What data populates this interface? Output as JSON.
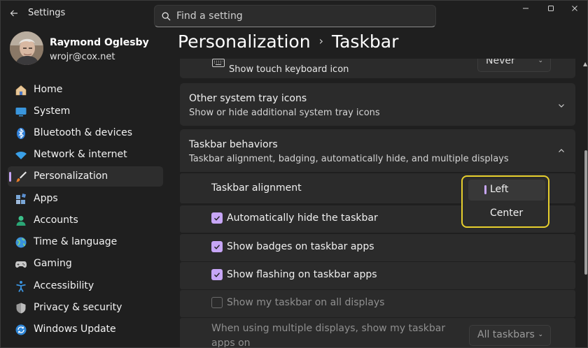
{
  "window": {
    "title": "Settings",
    "search_placeholder": "Find a setting"
  },
  "profile": {
    "name": "Raymond Oglesby",
    "email": "wrojr@cox.net"
  },
  "nav": {
    "items": [
      {
        "label": "Home",
        "icon": "home-icon"
      },
      {
        "label": "System",
        "icon": "system-icon"
      },
      {
        "label": "Bluetooth & devices",
        "icon": "bluetooth-icon"
      },
      {
        "label": "Network & internet",
        "icon": "wifi-icon"
      },
      {
        "label": "Personalization",
        "icon": "brush-icon",
        "active": true
      },
      {
        "label": "Apps",
        "icon": "apps-icon"
      },
      {
        "label": "Accounts",
        "icon": "accounts-icon"
      },
      {
        "label": "Time & language",
        "icon": "globe-icon"
      },
      {
        "label": "Gaming",
        "icon": "gamepad-icon"
      },
      {
        "label": "Accessibility",
        "icon": "accessibility-icon"
      },
      {
        "label": "Privacy & security",
        "icon": "shield-icon"
      },
      {
        "label": "Windows Update",
        "icon": "update-icon"
      }
    ]
  },
  "breadcrumb": {
    "parent": "Personalization",
    "separator": "›",
    "current": "Taskbar"
  },
  "touch_keyboard": {
    "subtitle": "Show touch keyboard icon",
    "dropdown_value": "Never"
  },
  "system_tray_card": {
    "title": "Other system tray icons",
    "subtitle": "Show or hide additional system tray icons"
  },
  "behaviors_card": {
    "title": "Taskbar behaviors",
    "subtitle": "Taskbar alignment, badging, automatically hide, and multiple displays"
  },
  "behaviors": {
    "alignment_label": "Taskbar alignment",
    "alignment_options": [
      "Left",
      "Center"
    ],
    "alignment_selected": "Left",
    "auto_hide": {
      "label": "Automatically hide the taskbar",
      "checked": true
    },
    "badges": {
      "label": "Show badges on taskbar apps",
      "checked": true
    },
    "flashing": {
      "label": "Show flashing on taskbar apps",
      "checked": true
    },
    "all_displays": {
      "label": "Show my taskbar on all displays",
      "checked": false
    },
    "multi_display": {
      "label_line1": "When using multiple displays, show my taskbar",
      "label_line2": "apps on",
      "dropdown_value": "All taskbars"
    }
  },
  "colors": {
    "accent": "#c7a6f6",
    "highlight_border": "#e7cf2d",
    "card_bg": "#2b2b2b",
    "window_bg": "#1f1f1f"
  }
}
